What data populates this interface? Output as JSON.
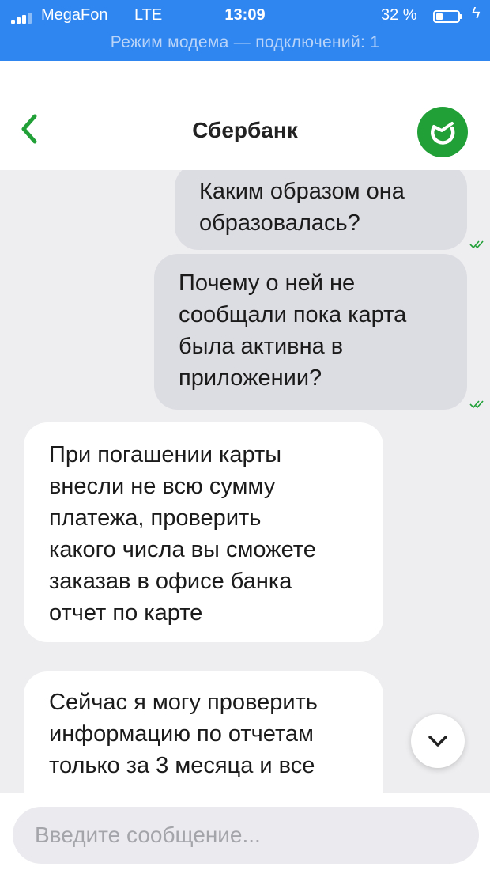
{
  "status_bar": {
    "carrier": "MegaFon",
    "network": "LTE",
    "time": "13:09",
    "battery_percent": "32 %",
    "battery_level": 0.32,
    "hotspot_text": "Режим модема — подключений: 1"
  },
  "header": {
    "title": "Сбербанк",
    "back_icon": "chevron-left-icon",
    "logo_icon": "sberbank-logo"
  },
  "messages": [
    {
      "direction": "outgoing",
      "lines": [
        "Каким образом она",
        "образовалась?"
      ],
      "read": true
    },
    {
      "direction": "outgoing",
      "lines": [
        "Почему о ней не",
        "сообщали пока карта",
        "была активна в",
        "приложении?"
      ],
      "read": true
    },
    {
      "direction": "incoming",
      "lines": [
        "При погашении карты",
        "внесли не всю сумму",
        "платежа, проверить",
        "какого числа вы сможете",
        "заказав в офисе банка",
        "отчет по карте"
      ]
    },
    {
      "direction": "incoming",
      "lines": [
        "Сейчас я могу проверить",
        "информацию по отчетам",
        "только за 3 месяца и все"
      ]
    }
  ],
  "scroll_button_icon": "chevron-down-icon",
  "composer": {
    "placeholder": "Введите сообщение...",
    "value": ""
  },
  "colors": {
    "status_bar": "#2f86f1",
    "accent_green": "#21a038",
    "outgoing_bubble": "#dcdce3",
    "incoming_bubble": "#ffffff",
    "chat_background": "#eeeef0"
  }
}
